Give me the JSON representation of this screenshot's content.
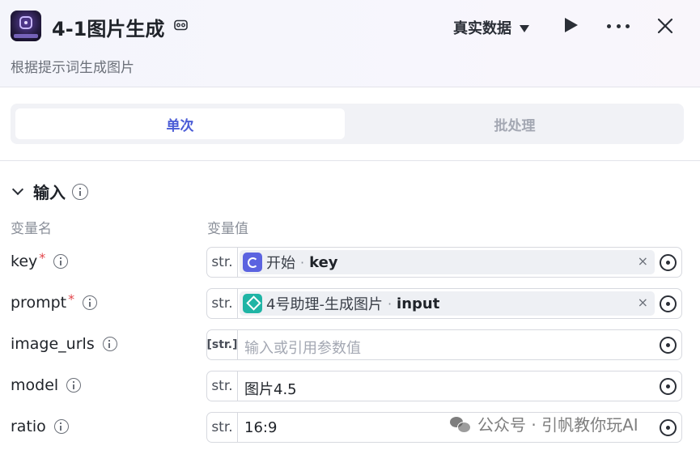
{
  "header": {
    "title": "4-1图片生成",
    "subtitle": "根据提示词生成图片",
    "data_source": "真实数据"
  },
  "tabs": [
    {
      "label": "单次",
      "active": true
    },
    {
      "label": "批处理",
      "active": false
    }
  ],
  "input_section": {
    "title": "输入",
    "col_name": "变量名",
    "col_value": "变量值",
    "rows": [
      {
        "name": "key",
        "required": "*",
        "type": "str.",
        "node": "开始",
        "sep": "·",
        "field": "key",
        "clear": "×"
      },
      {
        "name": "prompt",
        "required": "*",
        "type": "str.",
        "node": "4号助理-生成图片",
        "sep": "·",
        "field": "input",
        "clear": "×"
      },
      {
        "name": "image_urls",
        "type": "[str.]",
        "placeholder": "输入或引用参数值"
      },
      {
        "name": "model",
        "type": "str.",
        "value": "图片4.5"
      },
      {
        "name": "ratio",
        "type": "str.",
        "value": "16:9"
      }
    ]
  },
  "watermark": {
    "text": "公众号 · 引帆教你玩AI"
  },
  "colors": {
    "accent": "#4b5cd6",
    "required": "#e2454b",
    "start_node": "#5b63e0",
    "agent_node": "#1fb4a5"
  }
}
